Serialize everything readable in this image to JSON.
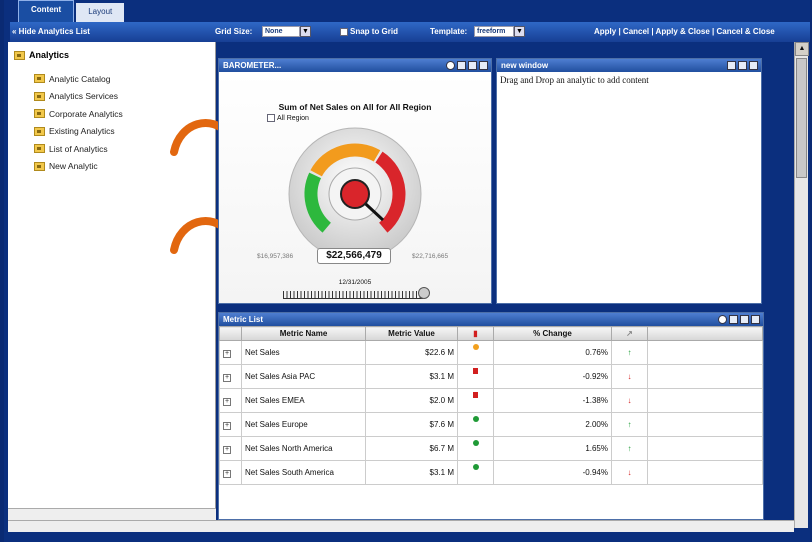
{
  "tabs": [
    {
      "label": "Content"
    },
    {
      "label": "Layout"
    }
  ],
  "toolbar": {
    "hide_label": "« Hide Analytics List",
    "grid_size_label": "Grid Size:",
    "grid_size_value": "None",
    "snap_label": "Snap to Grid",
    "template_label": "Template:",
    "template_value": "freeform",
    "actions": [
      "Apply",
      "Cancel",
      "Apply & Close",
      "Cancel & Close"
    ]
  },
  "tree": {
    "root": "Analytics",
    "items": [
      {
        "label": "Analytic Catalog"
      },
      {
        "label": "Analytics Services"
      },
      {
        "label": "Corporate Analytics"
      },
      {
        "label": "Existing Analytics"
      },
      {
        "label": "List of Analytics"
      },
      {
        "label": "New Analytic"
      }
    ]
  },
  "barometer": {
    "header": "BAROMETER...",
    "title": "Sum of Net Sales on All  for All Region",
    "checkbox_label": "All Region",
    "min_label": "$16,957,386",
    "max_label": "$22,716,665",
    "value_label": "$22,566,479",
    "date_label": "12/31/2005",
    "colors": {
      "low": "#2db83d",
      "mid": "#f29b1d",
      "high": "#d9252b",
      "needle": "#111111"
    }
  },
  "new_window": {
    "header": "new window",
    "message": "Drag and Drop an analytic to add content"
  },
  "metric_list": {
    "header": "Metric List",
    "columns": [
      "Metric Name",
      "Metric Value",
      "% Change"
    ],
    "rows": [
      {
        "name": "Net Sales",
        "value": "$22.6 M",
        "status": "dot",
        "status_color": "#f2a01e",
        "change": "0.76%",
        "trend": "up"
      },
      {
        "name": "Net Sales Asia PAC",
        "value": "$3.1 M",
        "status": "square",
        "status_color": "#d21f1f",
        "change": "-0.92%",
        "trend": "down"
      },
      {
        "name": "Net Sales EMEA",
        "value": "$2.0 M",
        "status": "square",
        "status_color": "#d21f1f",
        "change": "-1.38%",
        "trend": "down"
      },
      {
        "name": "Net Sales Europe",
        "value": "$7.6 M",
        "status": "dot",
        "status_color": "#1f9a36",
        "change": "2.00%",
        "trend": "up"
      },
      {
        "name": "Net Sales North America",
        "value": "$6.7 M",
        "status": "dot",
        "status_color": "#1f9a36",
        "change": "1.65%",
        "trend": "up"
      },
      {
        "name": "Net Sales South America",
        "value": "$3.1 M",
        "status": "dot",
        "status_color": "#1f9a36",
        "change": "-0.94%",
        "trend": "down"
      }
    ]
  }
}
